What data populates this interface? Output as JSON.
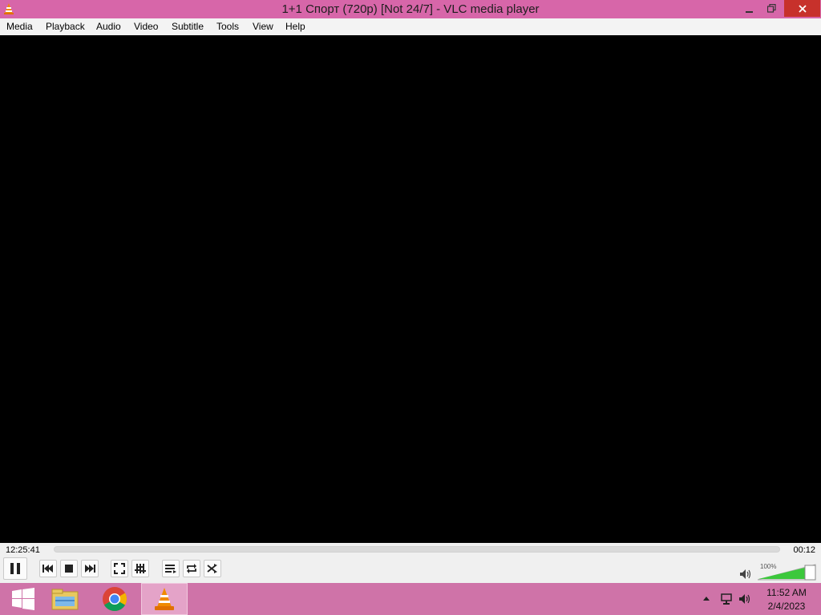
{
  "window": {
    "title": "1+1 Спорт (720p) [Not 24/7] - VLC media player"
  },
  "menu": [
    "Media",
    "Playback",
    "Audio",
    "Video",
    "Subtitle",
    "Tools",
    "View",
    "Help"
  ],
  "player": {
    "elapsed": "12:25:41",
    "total": "00:12",
    "seek_progress": 0,
    "volume_label": "100%",
    "volume_level": 1.0,
    "buttons": [
      {
        "name": "pause",
        "icon": "pause-icon"
      },
      {
        "name": "previous",
        "icon": "skip-previous-icon"
      },
      {
        "name": "stop",
        "icon": "stop-icon"
      },
      {
        "name": "next",
        "icon": "skip-next-icon"
      },
      {
        "name": "fullscreen",
        "icon": "fullscreen-icon"
      },
      {
        "name": "extended-settings",
        "icon": "equalizer-icon"
      },
      {
        "name": "playlist",
        "icon": "playlist-icon"
      },
      {
        "name": "loop",
        "icon": "loop-icon"
      },
      {
        "name": "random",
        "icon": "shuffle-icon"
      }
    ]
  },
  "taskbar": {
    "apps": [
      "start-button",
      "file-explorer",
      "google-chrome",
      "vlc-media-player"
    ],
    "active_app": "vlc-media-player",
    "clock_time": "11:52 AM",
    "clock_date": "2/4/2023"
  },
  "colors": {
    "titlebar": "#d766a9",
    "taskbar": "#cf73a8",
    "close_button": "#c7312b",
    "vlc_orange": "#f08a00",
    "volume_green": "#3cc83c"
  }
}
